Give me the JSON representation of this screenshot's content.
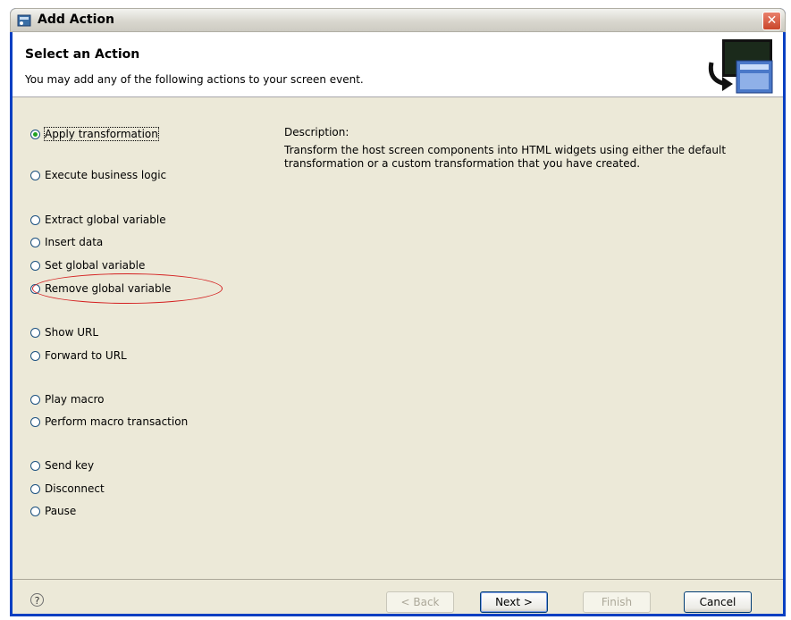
{
  "window": {
    "title": "Add Action",
    "close_glyph": "✕"
  },
  "banner": {
    "title": "Select an Action",
    "description": "You may add any of the following actions to your screen event."
  },
  "actions": [
    {
      "label": "Apply transformation",
      "checked": true
    },
    {
      "label": "Execute business logic",
      "checked": false
    },
    {
      "label": "Extract global variable",
      "checked": false
    },
    {
      "label": "Insert data",
      "checked": false
    },
    {
      "label": "Set global variable",
      "checked": false
    },
    {
      "label": "Remove global variable",
      "checked": false
    },
    {
      "label": "Show URL",
      "checked": false
    },
    {
      "label": "Forward to URL",
      "checked": false
    },
    {
      "label": "Play macro",
      "checked": false
    },
    {
      "label": "Perform macro transaction",
      "checked": false
    },
    {
      "label": "Send key",
      "checked": false
    },
    {
      "label": "Disconnect",
      "checked": false
    },
    {
      "label": "Pause",
      "checked": false
    }
  ],
  "description": {
    "label": "Description:",
    "text": "Transform the host screen components into HTML widgets using either the default transformation or a custom transformation that you have created."
  },
  "buttons": {
    "help": "?",
    "back": "< Back",
    "next": "Next >",
    "finish": "Finish",
    "cancel": "Cancel"
  },
  "colors": {
    "title_bar": "#d9d7cf",
    "dialog_bg": "#ece9d8",
    "highlight_ellipse": "#d42020",
    "radio_selected": "#21a121"
  }
}
